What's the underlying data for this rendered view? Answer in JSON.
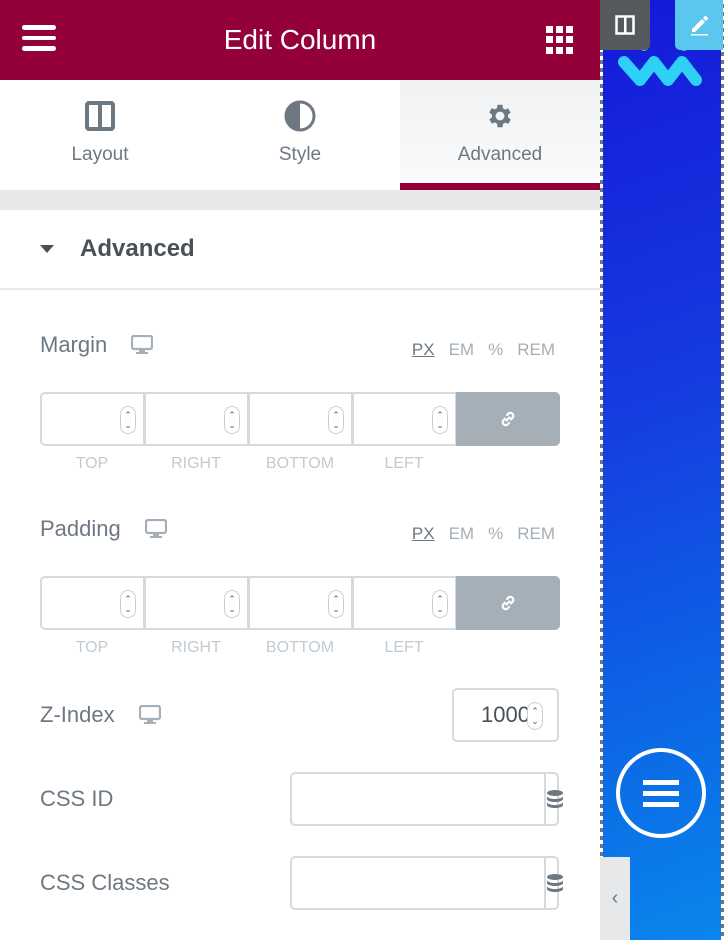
{
  "header": {
    "title": "Edit Column",
    "menu_icon": "hamburger-icon",
    "apps_icon": "grid-icon"
  },
  "tabs": [
    {
      "label": "Layout",
      "icon": "columns-icon",
      "active": false
    },
    {
      "label": "Style",
      "icon": "contrast-icon",
      "active": false
    },
    {
      "label": "Advanced",
      "icon": "gear-icon",
      "active": true
    }
  ],
  "section": {
    "title": "Advanced",
    "expanded": true
  },
  "margin": {
    "label": "Margin",
    "units": [
      "PX",
      "EM",
      "%",
      "REM"
    ],
    "selected_unit": "PX",
    "fields": [
      {
        "label": "TOP",
        "value": ""
      },
      {
        "label": "RIGHT",
        "value": ""
      },
      {
        "label": "BOTTOM",
        "value": ""
      },
      {
        "label": "LEFT",
        "value": ""
      }
    ],
    "linked": true
  },
  "padding": {
    "label": "Padding",
    "units": [
      "PX",
      "EM",
      "%",
      "REM"
    ],
    "selected_unit": "PX",
    "fields": [
      {
        "label": "TOP",
        "value": ""
      },
      {
        "label": "RIGHT",
        "value": ""
      },
      {
        "label": "BOTTOM",
        "value": ""
      },
      {
        "label": "LEFT",
        "value": ""
      }
    ],
    "linked": true
  },
  "zindex": {
    "label": "Z-Index",
    "value": "1000"
  },
  "css_id": {
    "label": "CSS ID",
    "value": ""
  },
  "css_classes": {
    "label": "CSS Classes",
    "value": ""
  },
  "colors": {
    "brand": "#93003a",
    "text": "#6d7882",
    "muted": "#a4afb7",
    "preview_blue": "#1639e0",
    "handle_edit": "#5bc6ee"
  }
}
